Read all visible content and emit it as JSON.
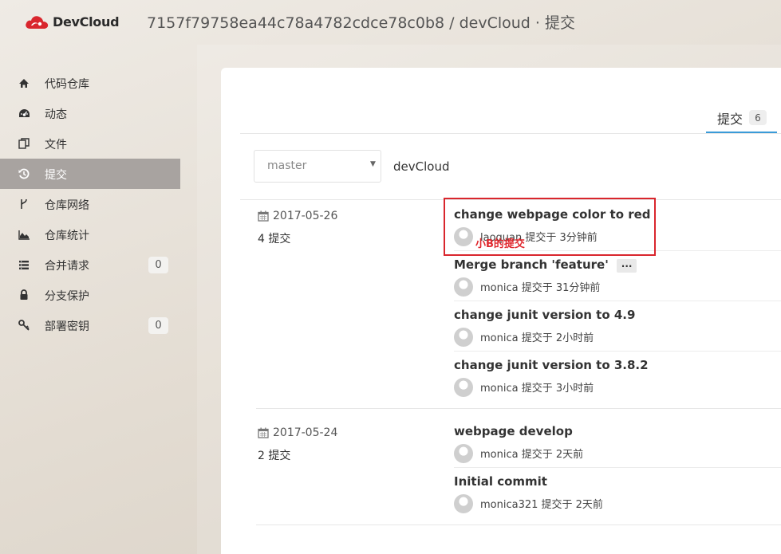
{
  "header": {
    "app_name": "DevCloud",
    "breadcrumb": "7157f79758ea44c78a4782cdce78c0b8 / devCloud · 提交"
  },
  "sidebar": {
    "items": [
      {
        "label": "代码仓库",
        "icon": "home-icon"
      },
      {
        "label": "动态",
        "icon": "dashboard-icon"
      },
      {
        "label": "文件",
        "icon": "files-icon"
      },
      {
        "label": "提交",
        "icon": "history-icon",
        "active": true
      },
      {
        "label": "仓库网络",
        "icon": "fork-icon"
      },
      {
        "label": "仓库统计",
        "icon": "area-chart-icon"
      },
      {
        "label": "合并请求",
        "icon": "list-icon",
        "badge": "0"
      },
      {
        "label": "分支保护",
        "icon": "lock-icon"
      },
      {
        "label": "部署密钥",
        "icon": "key-icon",
        "badge": "0"
      }
    ]
  },
  "tabs": {
    "commits_label": "提交",
    "commits_count": "6"
  },
  "branch": {
    "selected": "master",
    "repo": "devCloud"
  },
  "groups": [
    {
      "date": "2017-05-26",
      "count": "4 提交",
      "commits": [
        {
          "title": "change webpage color to red",
          "meta": "laoquan 提交于 3分钟前"
        },
        {
          "title": "Merge branch 'feature'",
          "meta": "monica 提交于 31分钟前",
          "more": "..."
        },
        {
          "title": "change junit version to 4.9",
          "meta": "monica 提交于 2小时前"
        },
        {
          "title": "change junit version to 3.8.2",
          "meta": "monica 提交于 3小时前"
        }
      ]
    },
    {
      "date": "2017-05-24",
      "count": "2 提交",
      "commits": [
        {
          "title": "webpage develop",
          "meta": "monica 提交于 2天前"
        },
        {
          "title": "Initial commit",
          "meta": "monica321 提交于 2天前"
        }
      ]
    }
  ],
  "annotation": {
    "text": "小B的提交",
    "color": "#e0272d"
  },
  "colors": {
    "accent": "#3a9bd8",
    "active_sidebar": "#a8a3a0",
    "logo_red": "#d9262d"
  }
}
